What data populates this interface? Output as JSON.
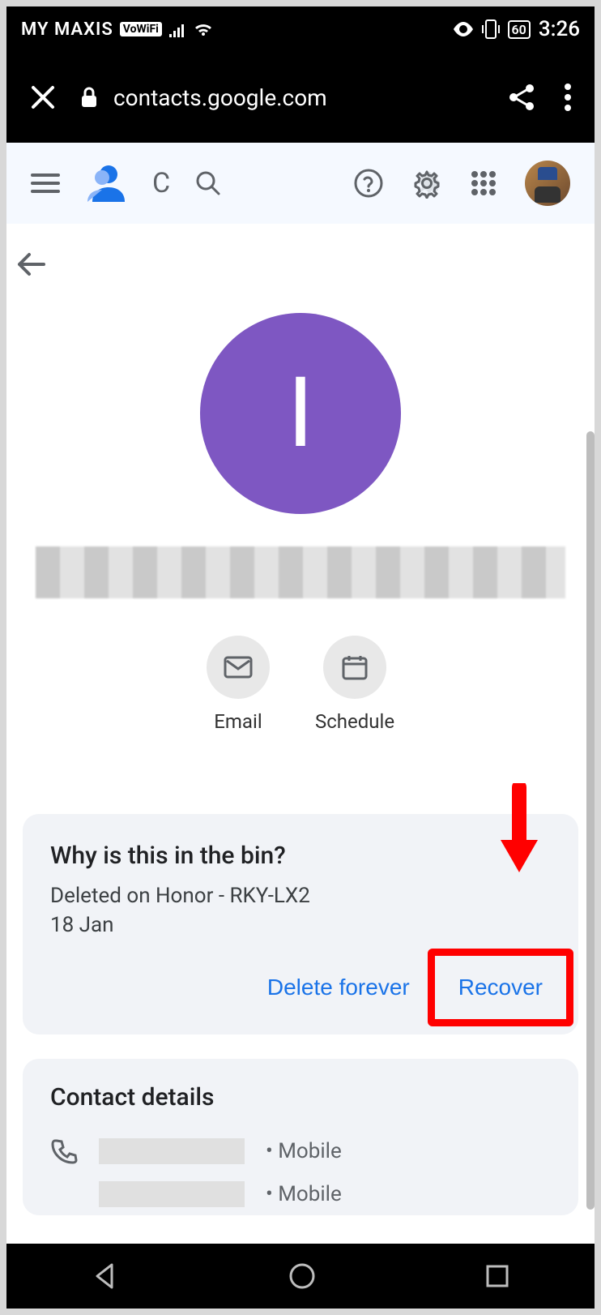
{
  "status_bar": {
    "carrier": "MY MAXIS",
    "vowifi_badge": "VoWiFi",
    "battery_pct": "60",
    "time": "3:26"
  },
  "browser": {
    "url": "contacts.google.com"
  },
  "contact": {
    "avatar_letter": "I"
  },
  "quick_actions": {
    "email": "Email",
    "schedule": "Schedule"
  },
  "bin_card": {
    "title": "Why is this in the bin?",
    "line1": "Deleted on Honor - RKY-LX2",
    "line2": "18 Jan",
    "delete_forever": "Delete forever",
    "recover": "Recover"
  },
  "details": {
    "title": "Contact details",
    "mobile_label": "Mobile"
  }
}
